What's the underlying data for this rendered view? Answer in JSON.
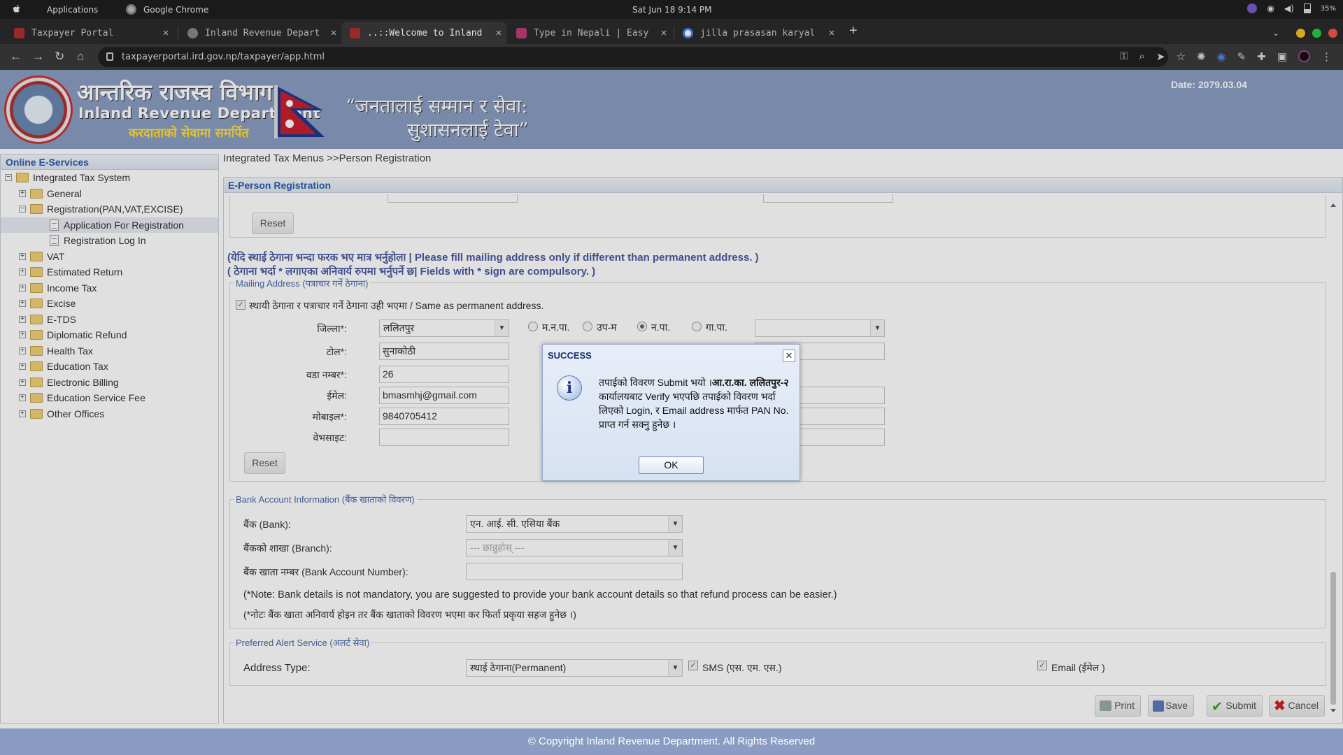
{
  "os": {
    "apps_label": "Applications",
    "chrome_label": "Google Chrome",
    "clock": "Sat Jun 18   9:14 PM",
    "battery": "35%"
  },
  "tabs": [
    {
      "title": "Taxpayer Portal",
      "fav_color": "#b03030"
    },
    {
      "title": "Inland Revenue Depart",
      "fav_color": "#888888"
    },
    {
      "title": "..::Welcome to Inland",
      "fav_color": "#b03030"
    },
    {
      "title": "Type in Nepali | Easy",
      "fav_color": "#c03a7a"
    },
    {
      "title": "jilla prasasan karyal",
      "fav_color": "#4285f4"
    }
  ],
  "url": "taxpayerportal.ird.gov.np/taxpayer/app.html",
  "header": {
    "title_np": "आन्तरिक राजस्व विभाग",
    "title_en": "Inland Revenue Department",
    "tagline": "करदाताको सेवामा समर्पित",
    "slogan_line1": "“जनतालाई सम्मान र सेवा:",
    "slogan_line2": "सुशासनलाई टेवा”",
    "date": "Date:  2079.03.04"
  },
  "sidebar": {
    "title": "Online E-Services",
    "items": [
      {
        "label": "Integrated Tax System",
        "level": 0,
        "type": "folder",
        "expand": "−"
      },
      {
        "label": "General",
        "level": 1,
        "type": "folder",
        "expand": "+"
      },
      {
        "label": "Registration(PAN,VAT,EXCISE)",
        "level": 1,
        "type": "folder",
        "expand": "−"
      },
      {
        "label": "Application For Registration",
        "level": 2,
        "type": "doc",
        "selected": true
      },
      {
        "label": "Registration Log In",
        "level": 2,
        "type": "doc"
      },
      {
        "label": "VAT",
        "level": 1,
        "type": "folder",
        "expand": "+"
      },
      {
        "label": "Estimated Return",
        "level": 1,
        "type": "folder",
        "expand": "+"
      },
      {
        "label": "Income Tax",
        "level": 1,
        "type": "folder",
        "expand": "+"
      },
      {
        "label": "Excise",
        "level": 1,
        "type": "folder",
        "expand": "+"
      },
      {
        "label": "E-TDS",
        "level": 1,
        "type": "folder",
        "expand": "+"
      },
      {
        "label": "Diplomatic Refund",
        "level": 1,
        "type": "folder",
        "expand": "+"
      },
      {
        "label": "Health Tax",
        "level": 1,
        "type": "folder",
        "expand": "+"
      },
      {
        "label": "Education Tax",
        "level": 1,
        "type": "folder",
        "expand": "+"
      },
      {
        "label": "Electronic Billing",
        "level": 1,
        "type": "folder",
        "expand": "+"
      },
      {
        "label": "Education Service Fee",
        "level": 1,
        "type": "folder",
        "expand": "+"
      },
      {
        "label": "Other Offices",
        "level": 1,
        "type": "folder",
        "expand": "+"
      }
    ]
  },
  "breadcrumb": "Integrated Tax Menus >>Person Registration",
  "panel_title": "E-Person Registration",
  "form": {
    "reset_label": "Reset",
    "notice_line1": "(येदि स्थाई ठेगाना भन्दा फरक भए मात्र भर्नुहोला | Please fill mailing address only if different than permanent address. )",
    "notice_line2": "( ठेगाना भर्दा * लगाएका अनिवार्य रुपमा भर्नुपर्ने छ| Fields with * sign are compulsory. )",
    "mailing_legend": "Mailing Address (पत्राचार गर्ने ठेगाना)",
    "same_as_permanent": "स्थायी ठेगाना र पत्राचार गर्ने ठेगाना उही भएमा / Same as permanent address.",
    "district_label": "जिल्ला*:",
    "district_value": "ललितपुर",
    "municipality_options": [
      "म.न.पा.",
      "उप-म",
      "न.पा.",
      "गा.पा."
    ],
    "tole_label": "टोल*:",
    "tole_value": "सुनाकोठी",
    "ward_label": "वडा नम्बर*:",
    "ward_value": "26",
    "email_label": "ईमेल:",
    "email_value": "bmasmhj@gmail.com",
    "mobile_label": "मोबाइल*:",
    "mobile_value": "9840705412",
    "website_label": "वेभसाइट:",
    "website_value": "",
    "bank_legend": "Bank Account Information (बैंक खाताको विवरण)",
    "bank_label": "बैंक (Bank):",
    "bank_value": "एन. आई. सी. एसिया बैंक",
    "branch_label": "बैंकको शाखा (Branch):",
    "branch_value": "--- छान्नुहोस् ---",
    "account_label": "बैंक खाता नम्बर (Bank Account Number):",
    "account_value": "",
    "bank_note_en": "(*Note: Bank details is not mandatory, you are suggested to provide your bank account details so that refund process can be easier.)",
    "bank_note_np": "(*नोटः बैंक खाता अनिवार्य होइन तर बैंक खाताको विवरण भएमा कर फिर्ता प्रकृया सहज हुनेछ ।)",
    "alert_legend": "Preferred Alert Service (अलर्ट सेवा)",
    "address_type_label": "Address Type:",
    "address_type_value": "स्थाई ठेगाना(Permanent)",
    "sms_label": "SMS (एस. एम. एस.)",
    "email_alert_label": "Email (ईमेल )"
  },
  "actions": {
    "print": "Print",
    "save": "Save",
    "submit": "Submit",
    "cancel": "Cancel"
  },
  "dialog": {
    "title": "SUCCESS",
    "message_a": "तपाईको विवरण Submit भयो ।",
    "message_b": "आ.रा.का. ललितपुर-२",
    "message_c": " कार्यालयबाट Verify भएपछि तपाईको विवरण भर्दा लिएको Login, र Email address मार्फत PAN No. प्राप्त गर्न सक्नु हुनेछ ।",
    "ok_label": "OK"
  },
  "footer": "© Copyright Inland Revenue Department. All Rights Reserved"
}
